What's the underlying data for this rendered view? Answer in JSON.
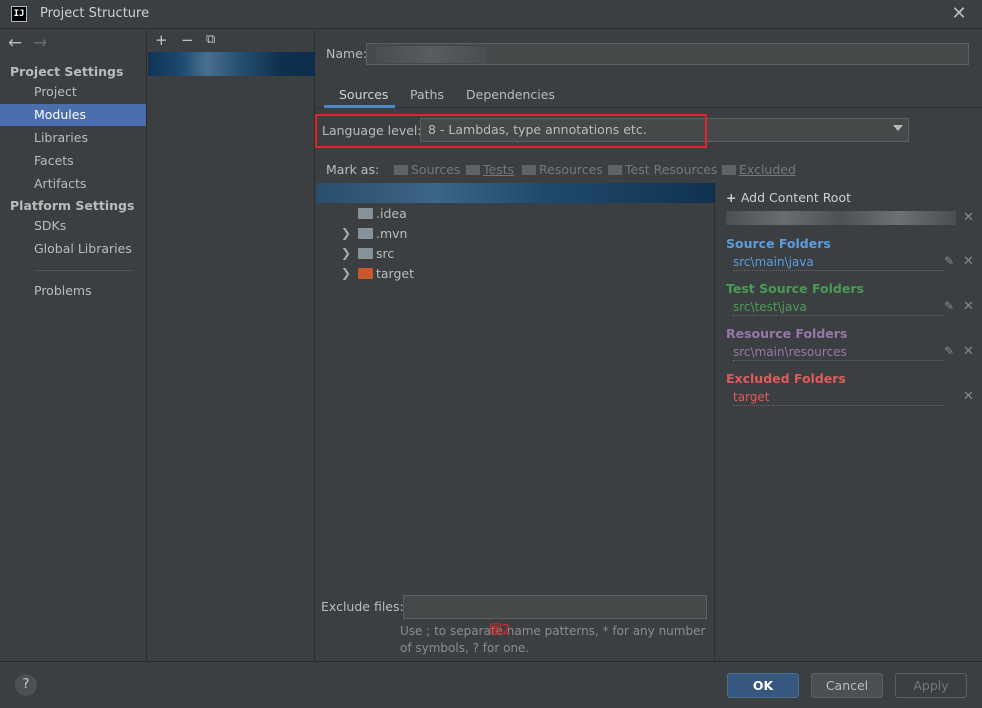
{
  "window": {
    "title": "Project Structure",
    "app_icon_text": "IJ",
    "close_glyph": "✕"
  },
  "nav": {
    "back_glyph": "←",
    "forward_glyph": "→",
    "project_settings_header": "Project Settings",
    "project_settings_items": [
      "Project",
      "Modules",
      "Libraries",
      "Facets",
      "Artifacts"
    ],
    "selected": "Modules",
    "platform_settings_header": "Platform Settings",
    "platform_settings_items": [
      "SDKs",
      "Global Libraries"
    ],
    "problems": "Problems"
  },
  "module_toolbar": {
    "add": "+",
    "remove": "−",
    "copy": "⧉"
  },
  "module": {
    "name_label": "Name:",
    "tabs": [
      "Sources",
      "Paths",
      "Dependencies"
    ],
    "active_tab": "Sources",
    "language_level_label": "Language level:",
    "language_level_value": "8 - Lambdas, type annotations etc.",
    "mark_as_label": "Mark as:",
    "mark_as_buttons": [
      "Sources",
      "Tests",
      "Resources",
      "Test Resources",
      "Excluded"
    ],
    "tree": [
      {
        "name": ".idea",
        "expandable": false,
        "icon": "folder-icon"
      },
      {
        "name": ".mvn",
        "expandable": true,
        "icon": "folder-icon"
      },
      {
        "name": "src",
        "expandable": true,
        "icon": "folder-icon"
      },
      {
        "name": "target",
        "expandable": true,
        "icon": "excluded-folder-icon"
      }
    ],
    "exclude_files_label": "Exclude files:",
    "exclude_files_value": "",
    "exclude_help_line1": "Use ; to separate name patterns, * for any number",
    "exclude_help_line2": "of symbols, ? for one.",
    "figure_label": "图2"
  },
  "content_roots": {
    "add_label": "Add Content Root",
    "sections": [
      {
        "title": "Source Folders",
        "path": "src\\main\\java",
        "color": "#5c9ddf"
      },
      {
        "title": "Test Source Folders",
        "path": "src\\test\\java",
        "color": "#499c54"
      },
      {
        "title": "Resource Folders",
        "path": "src\\main\\resources",
        "color": "#9876aa"
      },
      {
        "title": "Excluded Folders",
        "path": "target",
        "color": "#e05a5a"
      }
    ]
  },
  "buttons": {
    "help": "?",
    "ok": "OK",
    "cancel": "Cancel",
    "apply": "Apply"
  },
  "colors": {
    "background": "#3c3f41",
    "selection": "#4b6eaf",
    "highlight_box": "#e0242c"
  }
}
